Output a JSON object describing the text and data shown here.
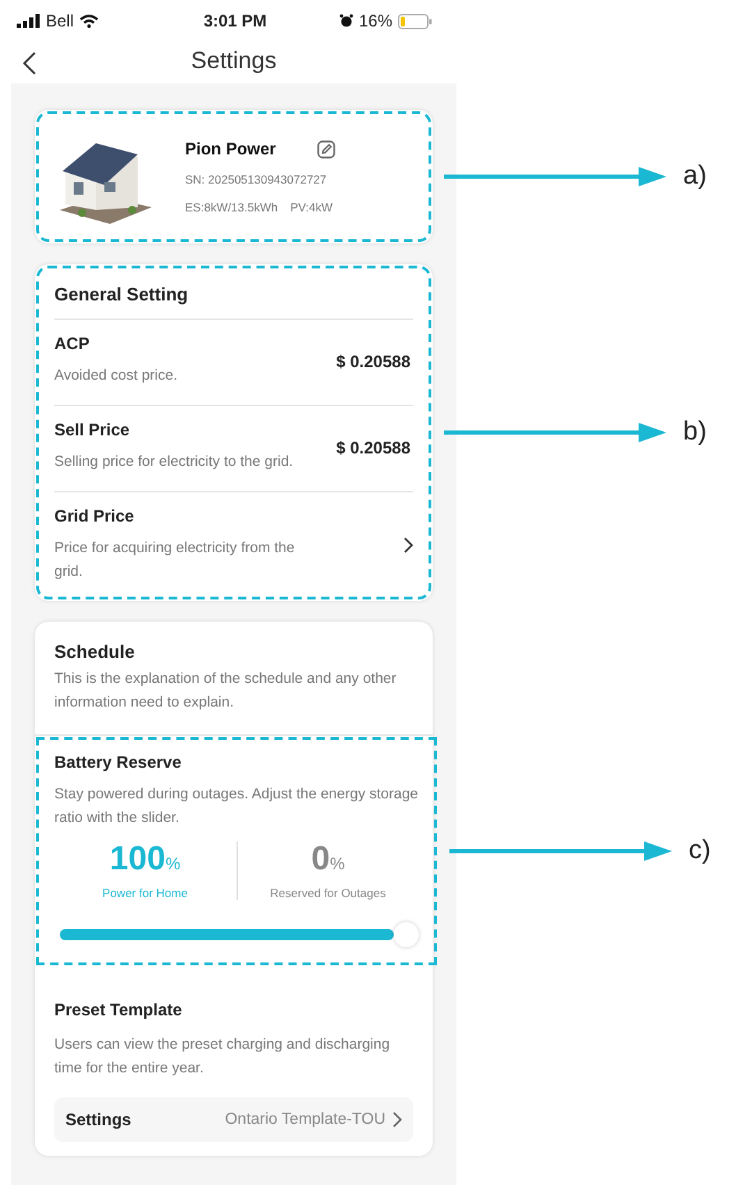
{
  "status_bar": {
    "carrier": "Bell",
    "time": "3:01 PM",
    "battery": "16%"
  },
  "nav": {
    "title": "Settings"
  },
  "device": {
    "name": "Pion Power",
    "serial": "SN: 202505130943072727",
    "specs": [
      "ES:8kW/13.5kWh",
      "PV:4kW"
    ],
    "callout": "a)"
  },
  "general": {
    "title": "General Setting",
    "callout": "b)",
    "items": [
      {
        "kind": "value",
        "title": "ACP",
        "description": "Avoided cost price.",
        "value": "$ 0.20588"
      },
      {
        "kind": "value",
        "title": "Sell Price",
        "description": "Selling price for electricity to the grid.",
        "value": "$ 0.20588"
      },
      {
        "kind": "link",
        "title": "Grid Price",
        "description": "Price for acquiring electricity from the grid."
      }
    ]
  },
  "schedule": {
    "title": "Schedule",
    "description": "This is the explanation of the schedule and any other information need to explain.",
    "battery_reserve": {
      "title": "Battery Reserve",
      "description": "Stay powered during outages. Adjust the energy storage ratio with the slider.",
      "callout": "c)",
      "home": {
        "value": "100",
        "unit": "%",
        "label": "Power for Home"
      },
      "outage": {
        "value": "0",
        "unit": "%",
        "label": "Reserved for Outages"
      },
      "slider": {
        "level": 1
      }
    },
    "preset": {
      "title": "Preset Template",
      "description": "Users can view the preset charging and discharging time for the entire year.",
      "row_label": "Settings",
      "row_value": "Ontario Template-TOU"
    }
  }
}
